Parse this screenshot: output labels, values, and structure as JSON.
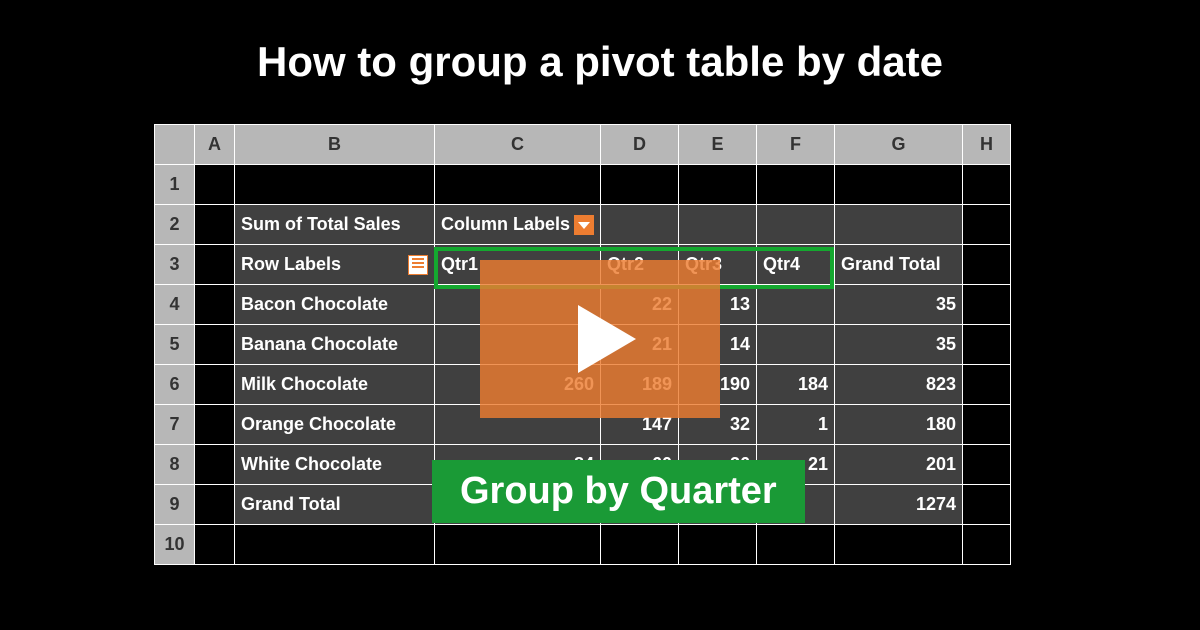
{
  "title": "How to group a pivot table by date",
  "caption": "Group by Quarter",
  "columns": [
    "A",
    "B",
    "C",
    "D",
    "E",
    "F",
    "G",
    "H"
  ],
  "rows": [
    "1",
    "2",
    "3",
    "4",
    "5",
    "6",
    "7",
    "8",
    "9",
    "10"
  ],
  "pivot": {
    "measure_label": "Sum of Total Sales",
    "column_labels_text": "Column Labels",
    "row_labels_text": "Row Labels",
    "col_headers": [
      "Qtr1",
      "Qtr2",
      "Qtr3",
      "Qtr4"
    ],
    "grand_total_label": "Grand Total",
    "data": [
      {
        "label": "Bacon Chocolate",
        "q1": "",
        "q2": "22",
        "q3": "13",
        "q4": "",
        "total": "35"
      },
      {
        "label": "Banana Chocolate",
        "q1": "",
        "q2": "21",
        "q3": "14",
        "q4": "",
        "total": "35"
      },
      {
        "label": "Milk Chocolate",
        "q1": "260",
        "q2": "189",
        "q3": "190",
        "q4": "184",
        "total": "823"
      },
      {
        "label": "Orange Chocolate",
        "q1": "",
        "q2": "147",
        "q3": "32",
        "q4": "1",
        "total": "180"
      },
      {
        "label": "White Chocolate",
        "q1": "84",
        "q2": "60",
        "q3": "36",
        "q4": "21",
        "total": "201"
      }
    ],
    "grand_total_row": {
      "label": "Grand Total",
      "total": "1274"
    }
  }
}
